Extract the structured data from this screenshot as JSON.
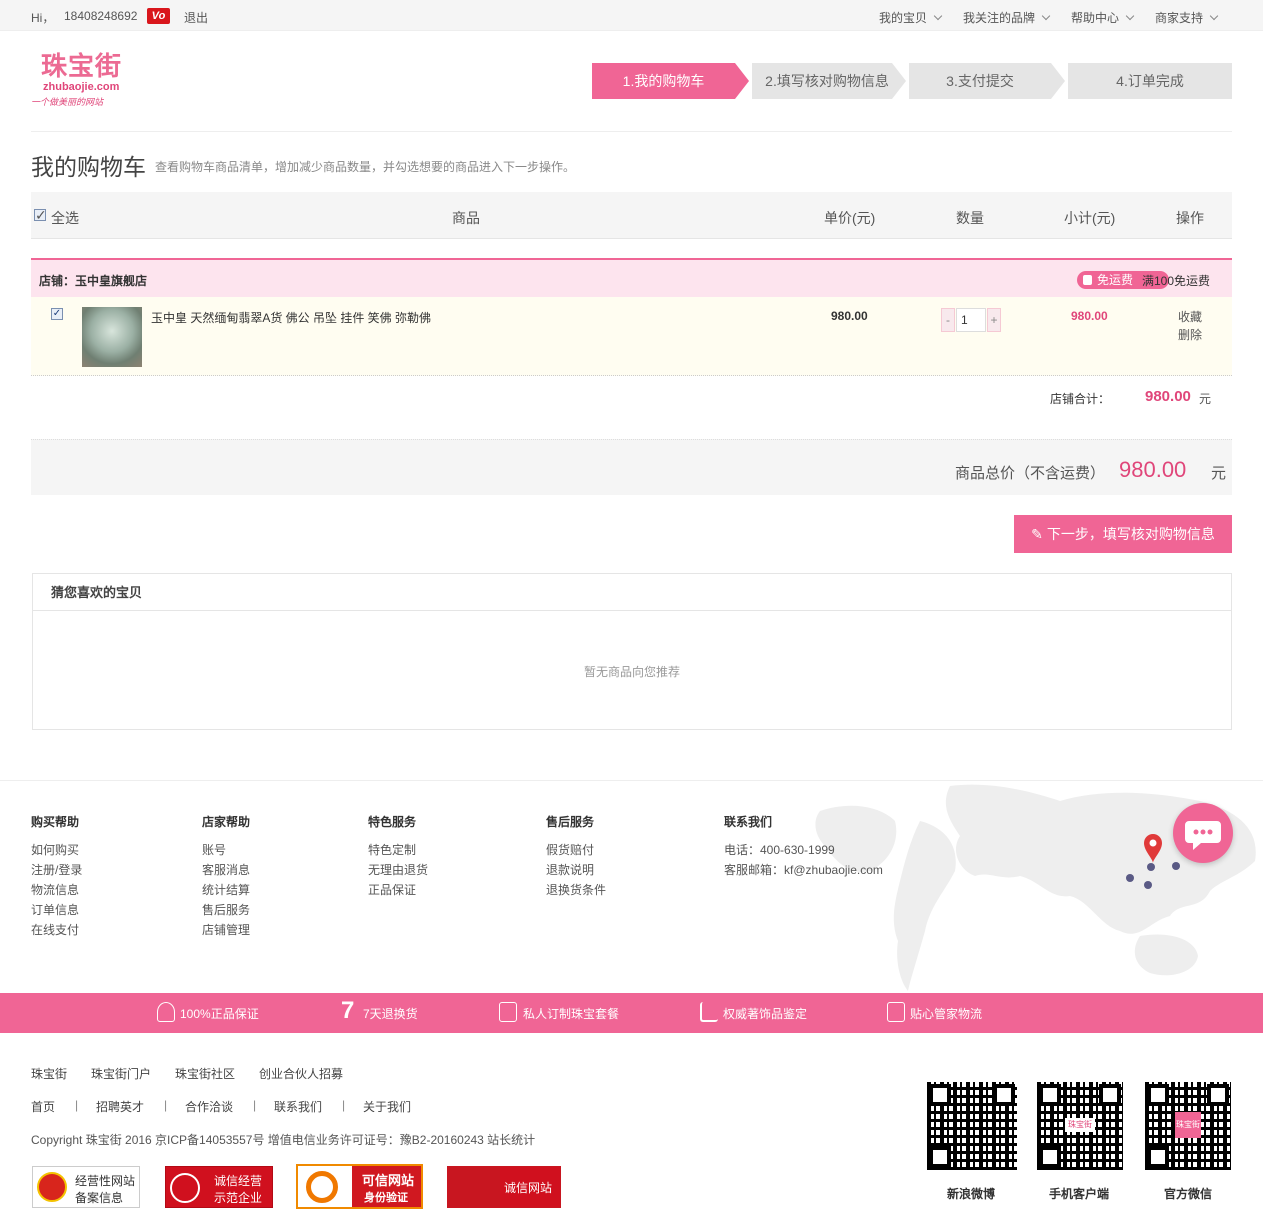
{
  "topbar": {
    "greeting": "Hi，",
    "phone": "18408248692",
    "vip": "Vo",
    "logout": "退出",
    "menus": [
      "我的宝贝",
      "我关注的品牌",
      "帮助中心",
      "商家支持"
    ]
  },
  "logo": {
    "name": "珠宝街",
    "domain": "zhubaojie.com",
    "slogan": "一个做美丽的网站"
  },
  "steps": [
    "1.我的购物车",
    "2.填写核对购物信息",
    "3.支付提交",
    "4.订单完成"
  ],
  "page": {
    "title": "我的购物车",
    "subtitle": "查看购物车商品清单，增加减少商品数量，并勾选想要的商品进入下一步操作。"
  },
  "table_head": {
    "select_all": "全选",
    "product": "商品",
    "unit_price": "单价(元)",
    "quantity": "数量",
    "subtotal": "小计(元)",
    "action": "操作"
  },
  "store": {
    "name": "店铺：玉中皇旗舰店",
    "free_badge": "免运费",
    "free_text": "满100免运费",
    "item": {
      "name": "玉中皇 天然缅甸翡翠A货 佛公 吊坠 挂件 笑佛 弥勒佛",
      "price": "980.00",
      "qty": "1",
      "subtotal": "980.00",
      "fav": "收藏",
      "del": "删除",
      "minus": "-",
      "plus": "+"
    },
    "sum_label": "店铺合计：",
    "sum_value": "980.00",
    "sum_unit": "元"
  },
  "total": {
    "label": "商品总价（不含运费）",
    "value": "980.00",
    "unit": "元"
  },
  "next_button": "下一步，填写核对购物信息",
  "guess": {
    "title": "猜您喜欢的宝贝",
    "empty": "暂无商品向您推荐"
  },
  "footer": {
    "cols": [
      {
        "title": "购买帮助",
        "items": [
          "如何购买",
          "注册/登录",
          "物流信息",
          "订单信息",
          "在线支付"
        ]
      },
      {
        "title": "店家帮助",
        "items": [
          "账号",
          "客服消息",
          "统计结算",
          "售后服务",
          "店铺管理"
        ]
      },
      {
        "title": "特色服务",
        "items": [
          "特色定制",
          "无理由退货",
          "正品保证"
        ]
      },
      {
        "title": "售后服务",
        "items": [
          "假货赔付",
          "退款说明",
          "退换货条件"
        ]
      },
      {
        "title": "联系我们",
        "items": [
          "电话：400-630-1999",
          "客服邮箱：kf@zhubaojie.com"
        ]
      }
    ],
    "promo": [
      "100%正品保证",
      "7",
      "7天退换货",
      "私人订制珠宝套餐",
      "权威著饰品鉴定",
      "贴心管家物流"
    ],
    "links1": [
      "珠宝街",
      "珠宝街门户",
      "珠宝街社区",
      "创业合伙人招募"
    ],
    "links2": [
      "首页",
      "招聘英才",
      "合作洽谈",
      "联系我们",
      "关于我们"
    ],
    "copyright": "Copyright 珠宝街 2016 京ICP备14053557号 增值电信业务许可证号：豫B2-20160243 站长统计",
    "badges": [
      {
        "l1": "经营性网站",
        "l2": "备案信息"
      },
      {
        "l1": "诚信经营",
        "l2": "示范企业"
      },
      {
        "l1": "可信网站",
        "l2": "身份验证"
      },
      {
        "l1": "诚信网站"
      }
    ],
    "qr": [
      "新浪微博",
      "手机客户端",
      "官方微信"
    ],
    "qr_mark": "珠宝街"
  },
  "colors": {
    "accent": "#f06595",
    "price": "#e0467a"
  }
}
